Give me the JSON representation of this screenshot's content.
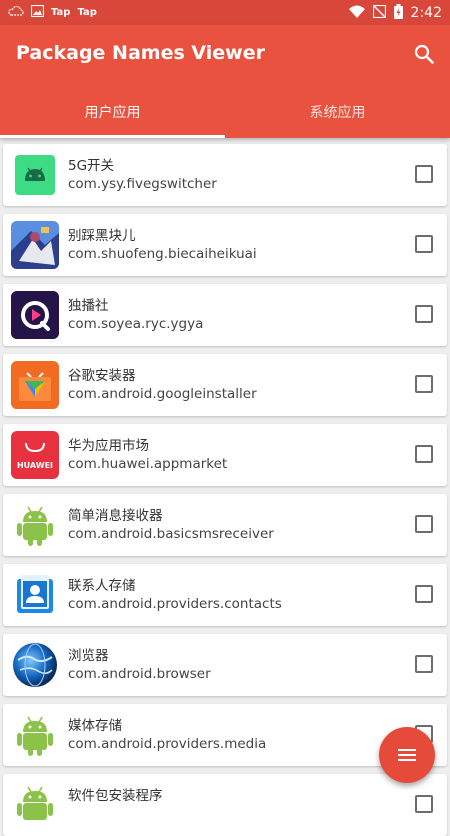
{
  "status_bar": {
    "notif1": "Tap",
    "notif2": "Tap",
    "time": "2:42"
  },
  "app": {
    "title": "Package Names Viewer"
  },
  "tabs": [
    {
      "label": "用户应用",
      "active": true
    },
    {
      "label": "系统应用",
      "active": false
    }
  ],
  "apps": [
    {
      "name": "5G开关",
      "package": "com.ysy.fivegswitcher",
      "icon": "android-green-icon",
      "checked": false
    },
    {
      "name": "别踩黑块儿",
      "package": "com.shuofeng.biecaiheikuai",
      "icon": "game-icon",
      "checked": false
    },
    {
      "name": "独播社",
      "package": "com.soyea.ryc.ygya",
      "icon": "video-play-icon",
      "checked": false
    },
    {
      "name": "谷歌安装器",
      "package": "com.android.googleinstaller",
      "icon": "google-installer-icon",
      "checked": false
    },
    {
      "name": "华为应用市场",
      "package": "com.huawei.appmarket",
      "icon": "huawei-appmarket-icon",
      "checked": false
    },
    {
      "name": "简单消息接收器",
      "package": "com.android.basicsmsreceiver",
      "icon": "android-robot-icon",
      "checked": false
    },
    {
      "name": "联系人存储",
      "package": "com.android.providers.contacts",
      "icon": "contacts-icon",
      "checked": false
    },
    {
      "name": "浏览器",
      "package": "com.android.browser",
      "icon": "browser-globe-icon",
      "checked": false
    },
    {
      "name": "媒体存储",
      "package": "com.android.providers.media",
      "icon": "android-robot-icon",
      "checked": false
    },
    {
      "name": "软件包安装程序",
      "package": "",
      "icon": "android-robot-icon",
      "checked": false
    }
  ],
  "huawei_label": "HUAWEI",
  "colors": {
    "primary": "#e8523f",
    "status_bar": "#d8473a",
    "fab": "#e64a3b"
  }
}
